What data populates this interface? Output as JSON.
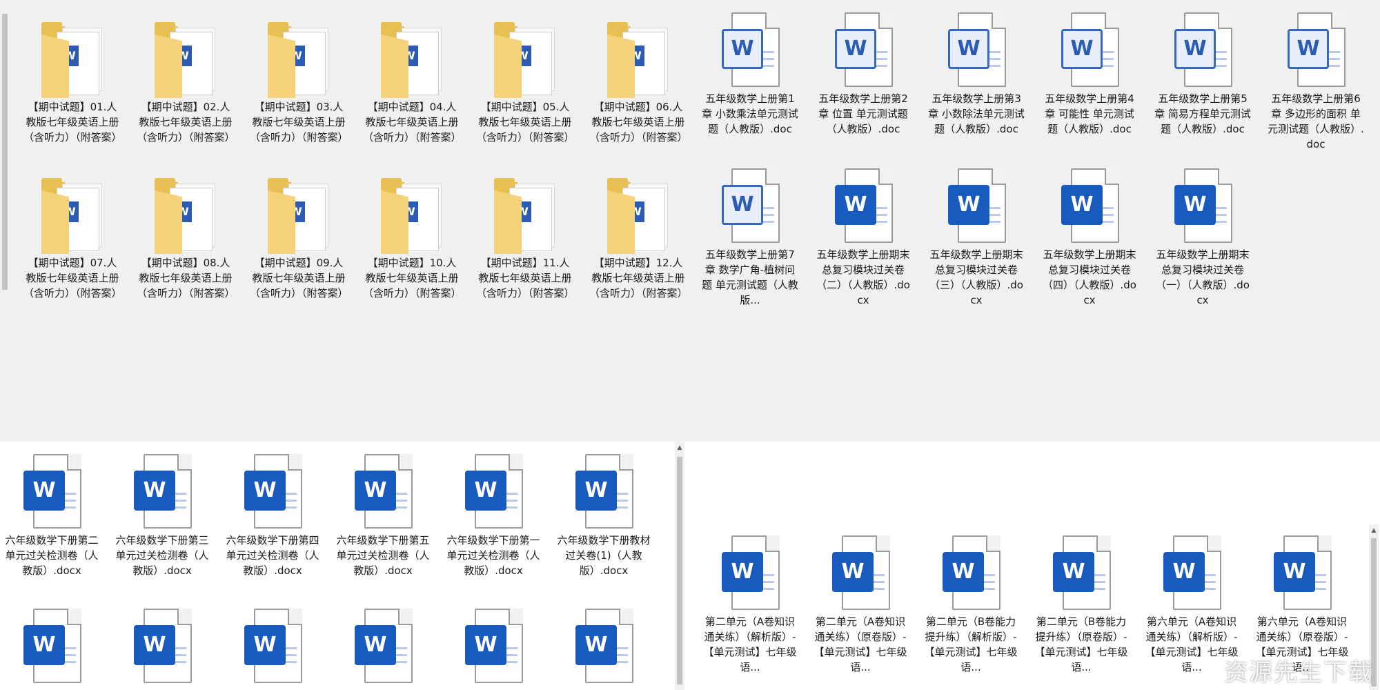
{
  "top_left": {
    "items": [
      "【期中试题】01.人教版七年级英语上册（含听力）（附答案）",
      "【期中试题】02.人教版七年级英语上册（含听力）（附答案）",
      "【期中试题】03.人教版七年级英语上册（含听力）（附答案）",
      "【期中试题】04.人教版七年级英语上册（含听力）（附答案）",
      "【期中试题】05.人教版七年级英语上册（含听力）（附答案）",
      "【期中试题】06.人教版七年级英语上册（含听力）（附答案）",
      "【期中试题】07.人教版七年级英语上册（含听力）（附答案）",
      "【期中试题】08.人教版七年级英语上册（含听力）（附答案）",
      "【期中试题】09.人教版七年级英语上册（含听力）（附答案）",
      "【期中试题】10.人教版七年级英语上册（含听力）（附答案）",
      "【期中试题】11.人教版七年级英语上册（含听力）（附答案）",
      "【期中试题】12.人教版七年级英语上册（含听力）（附答案）"
    ]
  },
  "top_right": {
    "items": [
      "五年级数学上册第1章 小数乘法单元测试题（人教版）.doc",
      "五年级数学上册第2章 位置 单元测试题（人教版）.doc",
      "五年级数学上册第3章 小数除法单元测试题（人教版）.doc",
      "五年级数学上册第4章 可能性 单元测试题（人教版）.doc",
      "五年级数学上册第5章 简易方程单元测试题（人教版）.doc",
      "五年级数学上册第6章 多边形的面积 单元测试题（人教版）.doc",
      "五年级数学上册第7章 数学广角-植树问题 单元测试题（人教版...",
      "五年级数学上册期末总复习模块过关卷（二）（人教版）.docx",
      "五年级数学上册期末总复习模块过关卷（三）（人教版）.docx",
      "五年级数学上册期末总复习模块过关卷（四）（人教版）.docx",
      "五年级数学上册期末总复习模块过关卷（一）（人教版）.docx"
    ]
  },
  "bottom_left": {
    "items": [
      "六年级数学下册第二单元过关检测卷（人教版）.docx",
      "六年级数学下册第三单元过关检测卷（人教版）.docx",
      "六年级数学下册第四单元过关检测卷（人教版）.docx",
      "六年级数学下册第五单元过关检测卷（人教版）.docx",
      "六年级数学下册第一单元过关检测卷（人教版）.docx",
      "六年级数学下册教材过关卷(1)（人教版）.docx",
      "",
      "",
      "",
      "",
      "",
      ""
    ]
  },
  "bottom_right": {
    "items": [
      "第二单元（A卷知识通关练）（解析版）-【单元测试】七年级语...",
      "第二单元（A卷知识通关练）（原卷版）-【单元测试】七年级语...",
      "第二单元（B卷能力提升练）（解析版）-【单元测试】七年级语...",
      "第二单元（B卷能力提升练）（原卷版）-【单元测试】七年级语...",
      "第六单元（A卷知识通关练）（解析版）-【单元测试】七年级语...",
      "第六单元（A卷知识通关练）（原卷版）-【单元测试】七年级语..."
    ]
  },
  "icons": {
    "folder": "folder-icon",
    "word": "word-doc-icon"
  },
  "watermark": "资源先生下载"
}
